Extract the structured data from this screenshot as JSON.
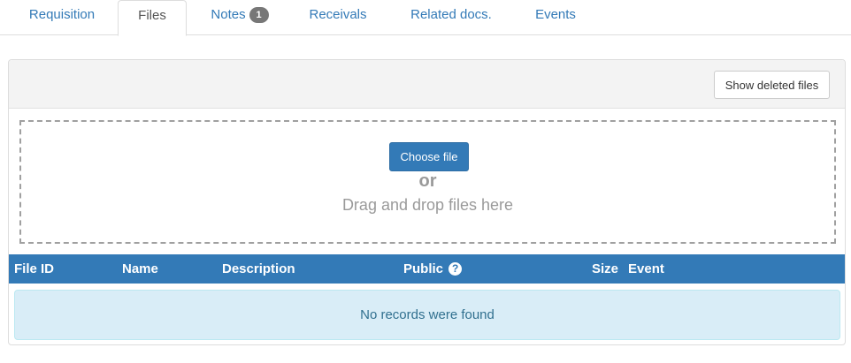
{
  "tabs": [
    {
      "label": "Requisition"
    },
    {
      "label": "Files"
    },
    {
      "label": "Notes",
      "badge": "1"
    },
    {
      "label": "Receivals"
    },
    {
      "label": "Related docs."
    },
    {
      "label": "Events"
    }
  ],
  "active_tab": "Files",
  "toolbar": {
    "show_deleted_label": "Show deleted files"
  },
  "dropzone": {
    "choose_label": "Choose file",
    "or_label": "or",
    "drag_text": "Drag and drop files here"
  },
  "table": {
    "columns": [
      "File ID",
      "Name",
      "Description",
      "Public",
      "Size",
      "Event"
    ],
    "empty_message": "No records were found"
  },
  "colors": {
    "primary": "#337ab7",
    "info_bg": "#d9edf7",
    "info_text": "#31708f",
    "badge": "#777777"
  },
  "icons": {
    "public_help": "question-circle-icon"
  }
}
